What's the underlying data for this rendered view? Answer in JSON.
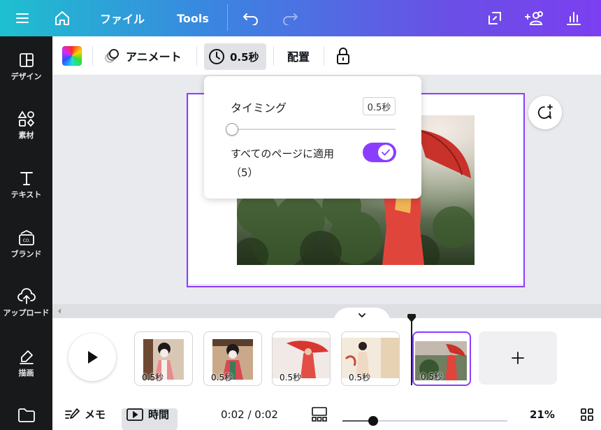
{
  "topbar": {
    "file_label": "ファイル",
    "tools_label": "Tools"
  },
  "sidebar": {
    "items": [
      {
        "label": "デザイン",
        "icon": "layout-icon"
      },
      {
        "label": "素材",
        "icon": "shapes-icon"
      },
      {
        "label": "テキスト",
        "icon": "text-icon"
      },
      {
        "label": "ブランド",
        "icon": "brand-icon"
      },
      {
        "label": "アップロード",
        "icon": "upload-icon"
      },
      {
        "label": "描画",
        "icon": "draw-icon"
      },
      {
        "label": "",
        "icon": "folder-icon"
      }
    ]
  },
  "toolbar": {
    "animate_label": "アニメート",
    "timing_label": "0.5秒",
    "position_label": "配置"
  },
  "popover": {
    "title": "タイミング",
    "value": "0.5秒",
    "slider_fraction": 0.0,
    "apply_label": "すべてのページに適用",
    "apply_count": "（5）",
    "apply_enabled": true
  },
  "timeline": {
    "pages": [
      {
        "duration": "0.5秒",
        "active": false
      },
      {
        "duration": "0.5秒",
        "active": false
      },
      {
        "duration": "0.5秒",
        "active": false
      },
      {
        "duration": "0.5秒",
        "active": false
      },
      {
        "duration": "0.5秒",
        "active": true
      }
    ]
  },
  "bottombar": {
    "notes_label": "メモ",
    "time_label": "時間",
    "time_readout": "0:02 / 0:02",
    "zoom": "21%",
    "zoom_fraction": 0.19
  },
  "colors": {
    "accent": "#8b3dff",
    "sidebar_bg": "#18191b",
    "topbar_gradient_start": "#1ec0cf",
    "topbar_gradient_end": "#7c3ff0"
  }
}
